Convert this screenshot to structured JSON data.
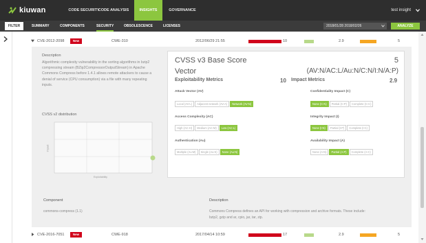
{
  "app": {
    "logo_text": "kiuwan",
    "user": "test insight"
  },
  "nav": {
    "items": [
      "CODE SECURITY",
      "CODE ANALYSIS",
      "INSIGHTS",
      "GOVERNANCE"
    ],
    "active": "INSIGHTS"
  },
  "subnav": {
    "filter_label": "FILTER",
    "items": [
      "SUMMARY",
      "COMPONENTS",
      "SECURITY",
      "OBSOLESCENCE",
      "LICENSES"
    ],
    "active": "SECURITY",
    "date_range": "2018/01/28  2018/02/26",
    "analyze_label": "ANALYZE"
  },
  "rows": [
    {
      "cve": "CVE-2012-2098",
      "badge": "New",
      "cwe": "CWE-310",
      "date": "2012/06/29 21:55",
      "score1": "10",
      "score2": "2.9",
      "score3": "5"
    },
    {
      "cve": "CVE-2016-7051",
      "badge": "New",
      "cwe": "CWE-918",
      "date": "2017/04/14 10:59",
      "score1": "17",
      "score2": "2.9",
      "score3": "5"
    }
  ],
  "detail": {
    "description_label": "Description",
    "description_text": "Algorithmic complexity vulnerability in the sorting algorithms in bzip2 compressing stream (BZip2CompressorOutputStream) in Apache Commons Compress before 1.4.1 allows remote attackers to cause a denial of service (CPU consumption) via a file with many repeating inputs.",
    "cvss_v2_label": "CVSS v2 distribution",
    "chart_y_label": "Impact",
    "chart_x_label": "Exploitability",
    "cvss": {
      "title": "CVSS v3 Base Score",
      "score": "5",
      "vector_label": "Vector",
      "vector_value": "(AV:N/AC:L/Au:N/C:N/I:N/A:P)",
      "exploitability_label": "Exploitability Metrics",
      "exploitability_value": "10",
      "impact_label": "Impact Metrics",
      "impact_value": "2.9",
      "attack_vector": {
        "label": "Attack Vector (AV)",
        "options": [
          "Local (AV:L)",
          "Adjacent network (AV:A)",
          "Network (AV:N)"
        ],
        "selected": 2
      },
      "access_complexity": {
        "label": "Access Complexity (AC)",
        "options": [
          "High (AC:H)",
          "Medium (AC:M)",
          "Low (AC:L)"
        ],
        "selected": 2
      },
      "authentication": {
        "label": "Authentication (Au)",
        "options": [
          "Multiple (Au:M)",
          "Single (Au:S)",
          "None (Au:N)"
        ],
        "selected": 2
      },
      "confidentiality": {
        "label": "Confidentiality Impact (C)",
        "options": [
          "None (C:N)",
          "Partial (C:P)",
          "Complete (C:C)"
        ],
        "selected": 0
      },
      "integrity": {
        "label": "Integrity Impact (I)",
        "options": [
          "None (I:N)",
          "Partial (I:P)",
          "Complete (I:C)"
        ],
        "selected": 0
      },
      "availability": {
        "label": "Availability Impact (A)",
        "options": [
          "None (A:N)",
          "Partial (A:P)",
          "Complete (A:C)"
        ],
        "selected": 1
      }
    },
    "component_label": "Component",
    "component_value": "commons-compress (1.1)",
    "component_desc_label": "Description",
    "component_desc_text": "Commons Compress defines an API for working with compression and archive formats. These include: bzip2, gzip and ar, cpio, jar, tar, zip."
  },
  "colors": {
    "accent": "#8cc63f",
    "danger": "#d0021b",
    "warning": "#f5a623",
    "nav_bg": "#2e2e2e"
  },
  "icons": {
    "logo": "kiuwan-leaf-icon",
    "expand": "chevron-right-icon",
    "dropdown": "chevron-down-icon"
  }
}
